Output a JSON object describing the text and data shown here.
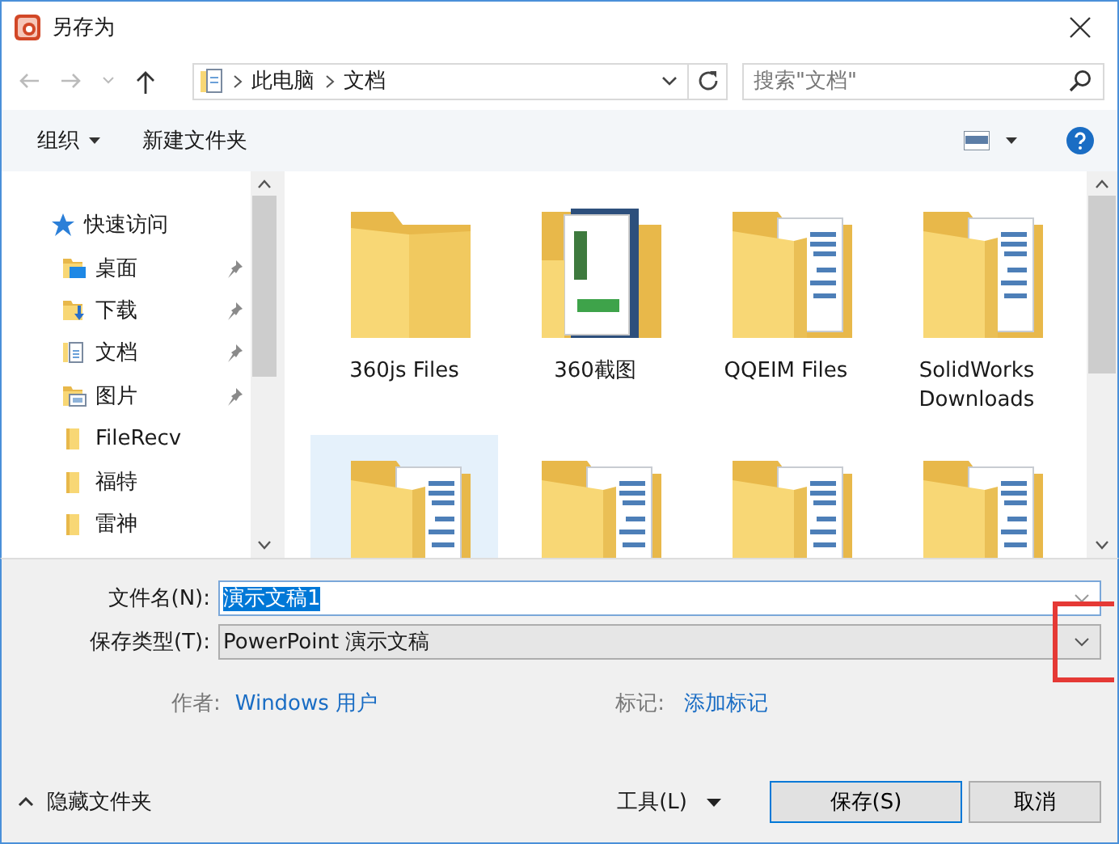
{
  "window": {
    "title": "另存为"
  },
  "address": {
    "crumbs": [
      "此电脑",
      "文档"
    ]
  },
  "search": {
    "placeholder": "搜索\"文档\""
  },
  "toolbar": {
    "organize": "组织",
    "new_folder": "新建文件夹"
  },
  "nav": {
    "items": [
      {
        "label": "快速访问",
        "kind": "star",
        "pinned": false,
        "children": [
          {
            "label": "桌面",
            "kind": "desktop",
            "pinned": true
          },
          {
            "label": "下载",
            "kind": "download",
            "pinned": true
          },
          {
            "label": "文档",
            "kind": "document",
            "pinned": true
          },
          {
            "label": "图片",
            "kind": "picture",
            "pinned": true
          },
          {
            "label": "FileRecv",
            "kind": "folder",
            "pinned": false
          },
          {
            "label": "福特",
            "kind": "folder",
            "pinned": false
          },
          {
            "label": "雷神",
            "kind": "folder",
            "pinned": false
          }
        ]
      }
    ]
  },
  "files": [
    {
      "label": "360js Files",
      "kind": "folder",
      "selected": false
    },
    {
      "label": "360截图",
      "kind": "folder-book",
      "selected": false
    },
    {
      "label": "QQEIM Files",
      "kind": "folder-docs",
      "selected": false
    },
    {
      "label": "SolidWorks Downloads",
      "kind": "folder-docs",
      "selected": false
    },
    {
      "kind": "folder-docs",
      "selected": true
    },
    {
      "kind": "folder-docs",
      "selected": false
    },
    {
      "kind": "folder-docs",
      "selected": false
    },
    {
      "kind": "folder-docs",
      "selected": false
    }
  ],
  "form": {
    "filename_label": "文件名(N):",
    "filename": "演示文稿1",
    "filename_selected": true,
    "type_label": "保存类型(T):",
    "type": "PowerPoint 演示文稿",
    "author_label": "作者:",
    "author": "Windows 用户",
    "tags_label": "标记:",
    "tags": "添加标记"
  },
  "footer": {
    "hide_folders": "隐藏文件夹",
    "tools": "工具(L)",
    "buttons": [
      "保存(S)",
      "取消"
    ]
  }
}
